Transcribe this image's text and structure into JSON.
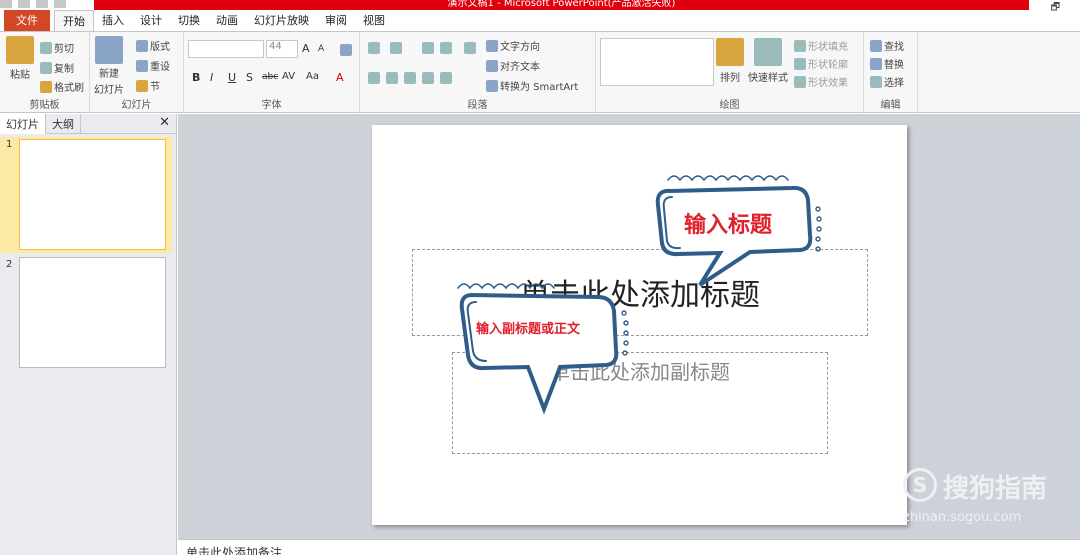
{
  "window": {
    "title": "演示文稿1 - Microsoft PowerPoint(产品激活失败)",
    "restore_glyph": "🗗"
  },
  "tabs": [
    {
      "label": "文件",
      "active": false
    },
    {
      "label": "开始",
      "active": true
    },
    {
      "label": "插入",
      "active": false
    },
    {
      "label": "设计",
      "active": false
    },
    {
      "label": "切换",
      "active": false
    },
    {
      "label": "动画",
      "active": false
    },
    {
      "label": "幻灯片放映",
      "active": false
    },
    {
      "label": "审阅",
      "active": false
    },
    {
      "label": "视图",
      "active": false
    }
  ],
  "ribbon": {
    "clipboard": {
      "label": "剪贴板",
      "paste": "粘贴",
      "cut": "剪切",
      "copy": "复制",
      "format_painter": "格式刷"
    },
    "slides": {
      "label": "幻灯片",
      "new_slide_1": "新建",
      "new_slide_2": "幻灯片",
      "layout": "版式",
      "reset": "重设",
      "section": "节"
    },
    "font": {
      "label": "字体",
      "font_name": "",
      "font_size": "44",
      "grow": "A",
      "shrink": "A",
      "bold": "B",
      "italic": "I",
      "underline": "U",
      "shadow": "S",
      "strike": "abc",
      "spacing": "AV",
      "case": "Aa",
      "color": "A"
    },
    "paragraph": {
      "label": "段落",
      "text_direction": "文字方向",
      "align_text": "对齐文本",
      "smartart": "转换为 SmartArt"
    },
    "drawing": {
      "label": "绘图",
      "arrange": "排列",
      "quick_styles": "快速样式",
      "shape_fill": "形状填充",
      "shape_outline": "形状轮廓",
      "shape_effects": "形状效果"
    },
    "editing": {
      "label": "编辑",
      "find": "查找",
      "replace": "替换",
      "select": "选择"
    }
  },
  "left_pane": {
    "tabs": [
      "幻灯片",
      "大纲"
    ],
    "close_glyph": "✕",
    "slides": [
      {
        "number": "1",
        "selected": true
      },
      {
        "number": "2",
        "selected": false
      }
    ]
  },
  "slide": {
    "title_placeholder": "单击此处添加标题",
    "subtitle_placeholder": "单击此处添加副标题",
    "callout_title": "输入标题",
    "callout_subtitle": "输入副标题或正文"
  },
  "watermark": {
    "logo": "S",
    "brand": "搜狗指南",
    "url": "zhinan.sogou.com"
  },
  "notes": {
    "placeholder": "单击此处添加备注"
  },
  "colors": {
    "title_bar": "#e0000d",
    "file_tab": "#d24726",
    "callout_text": "#e0202b",
    "callout_outline": "#2f5d8a",
    "canvas_bg": "#cdd1d8"
  }
}
